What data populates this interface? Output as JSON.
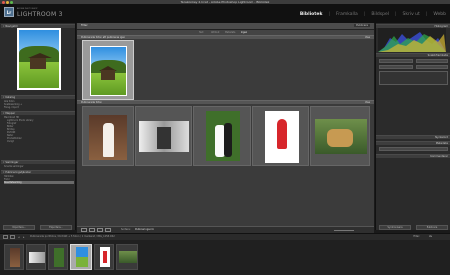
{
  "window": {
    "title": "Terakonkey 2.lrcat - Adobe Photoshop Lightroom - Bibliotek"
  },
  "identity": {
    "badge": "Lr",
    "small": "ADOBE PHOTOSHOP",
    "name": "LIGHTROOM 3"
  },
  "modules": [
    "Bibliotek",
    "Framkalla",
    "Bildspel",
    "Skriv ut",
    "Webb"
  ],
  "left_panel": {
    "navigator_label": "Navigatör",
    "katalog_label": "Katalog",
    "katalog_rows": [
      "Alla foton",
      "Snabbsamling +",
      "Föreg. import"
    ],
    "mappar_label": "Mappar",
    "mappar_rows": [
      "Macintosh HD",
      "Lightroom Photo Library",
      "Fotograf",
      "Bilder",
      "Bröllop",
      "Porträtt",
      "Natur",
      "Produktbilder",
      "Övrigt"
    ],
    "samlingar_label": "Samlingar",
    "samlingar_rows": [
      "Smarta samlingar"
    ],
    "publicering_label": "Publiceringstjänster",
    "publicering_rows": [
      "Hårddisk",
      "Flickr",
      "Resultatsamling"
    ],
    "import_button": "Importera...",
    "export_button": "Exportera..."
  },
  "center": {
    "filter_label": "Filter:",
    "filter_right": "Publicera",
    "filter_tabs": [
      "Text",
      "Attribut",
      "Metadata",
      "Ingen"
    ],
    "section1_label": "Publicerade foton att publiceras igen",
    "section2_label": "Publicerade foton",
    "section_right": "Visa"
  },
  "right_panel": {
    "histogram_label": "Histogram",
    "snabb_label": "Snabbframkalla",
    "nyckelord_label": "Nyckelord",
    "metadata_label": "Metadata",
    "kommentarer_label": "Kommentarer",
    "button_sync": "Synkronisera",
    "button_publish": "Publicera"
  },
  "toolbar": {
    "sort_label": "Sortera:",
    "sort_value": "Publiceringsord."
  },
  "filmstrip": {
    "info": "Publicerade portfolios / Porträtt + 5 foton / 1 markerat / IMG_1258.CR2",
    "filter_label": "Filter:",
    "filter_value": "Av"
  }
}
